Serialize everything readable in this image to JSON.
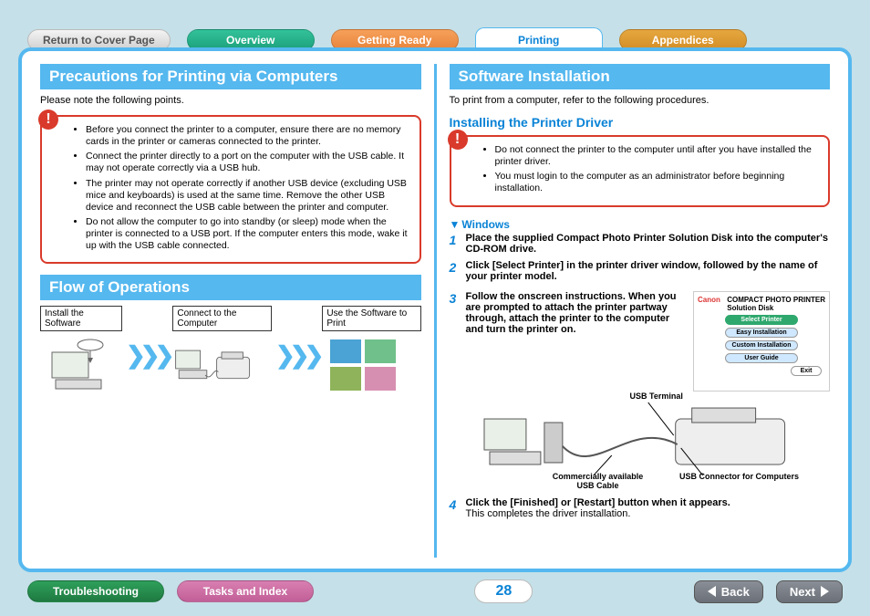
{
  "nav": {
    "return": "Return to Cover Page",
    "overview": "Overview",
    "getting_ready": "Getting Ready",
    "printing": "Printing",
    "appendices": "Appendices"
  },
  "left": {
    "h_precautions": "Precautions for Printing via Computers",
    "precautions_intro": "Please note the following points.",
    "precaution_items": [
      "Before you connect the printer to a computer, ensure there are no memory cards in the printer or cameras connected to the printer.",
      "Connect the printer directly to a port on the computer with the USB cable. It may not operate correctly via a USB hub.",
      "The printer may not operate correctly if another USB device (excluding USB mice and keyboards) is used at the same time. Remove the other USB device and reconnect the USB cable between the printer and computer.",
      "Do not allow the computer to go into standby (or sleep) mode when the printer is connected to a USB port. If the computer enters this mode, wake it up with the USB cable connected."
    ],
    "h_flow": "Flow of Operations",
    "flow_labels": [
      "Install the Software",
      "Connect to the Computer",
      "Use the Software to Print"
    ]
  },
  "right": {
    "h_software": "Software Installation",
    "software_intro": "To print from a computer, refer to the following procedures.",
    "sub_install": "Installing the Printer Driver",
    "warn_items": [
      "Do not connect the printer to the computer until after you have installed the printer driver.",
      "You must login to the computer as an administrator before beginning installation."
    ],
    "os_head": "Windows",
    "steps": [
      "Place the supplied Compact Photo Printer Solution Disk into the computer's CD-ROM drive.",
      "Click [Select Printer] in the printer driver window, followed by the name of your printer model.",
      "Follow the onscreen instructions. When you are prompted to attach the printer partway through, attach the printer to the computer and turn the printer on.",
      "Click the [Finished] or [Restart] button when it appears."
    ],
    "step4_note": "This completes the driver installation.",
    "disk": {
      "brand": "Canon",
      "title_a": "COMPACT PHOTO",
      "title_b": "PRINTER",
      "subtitle": "Solution Disk",
      "btn_select": "Select Printer",
      "btn_easy": "Easy Installation",
      "btn_custom": "Custom Installation",
      "btn_guide": "User Guide",
      "btn_exit": "Exit"
    },
    "diagram": {
      "usb_terminal": "USB Terminal",
      "usb_cable": "Commercially available USB Cable",
      "usb_connector": "USB Connector for Computers"
    }
  },
  "footer": {
    "troubleshooting": "Troubleshooting",
    "tasks": "Tasks and Index",
    "page": "28",
    "back": "Back",
    "next": "Next"
  },
  "icons": {
    "bang": "!"
  }
}
